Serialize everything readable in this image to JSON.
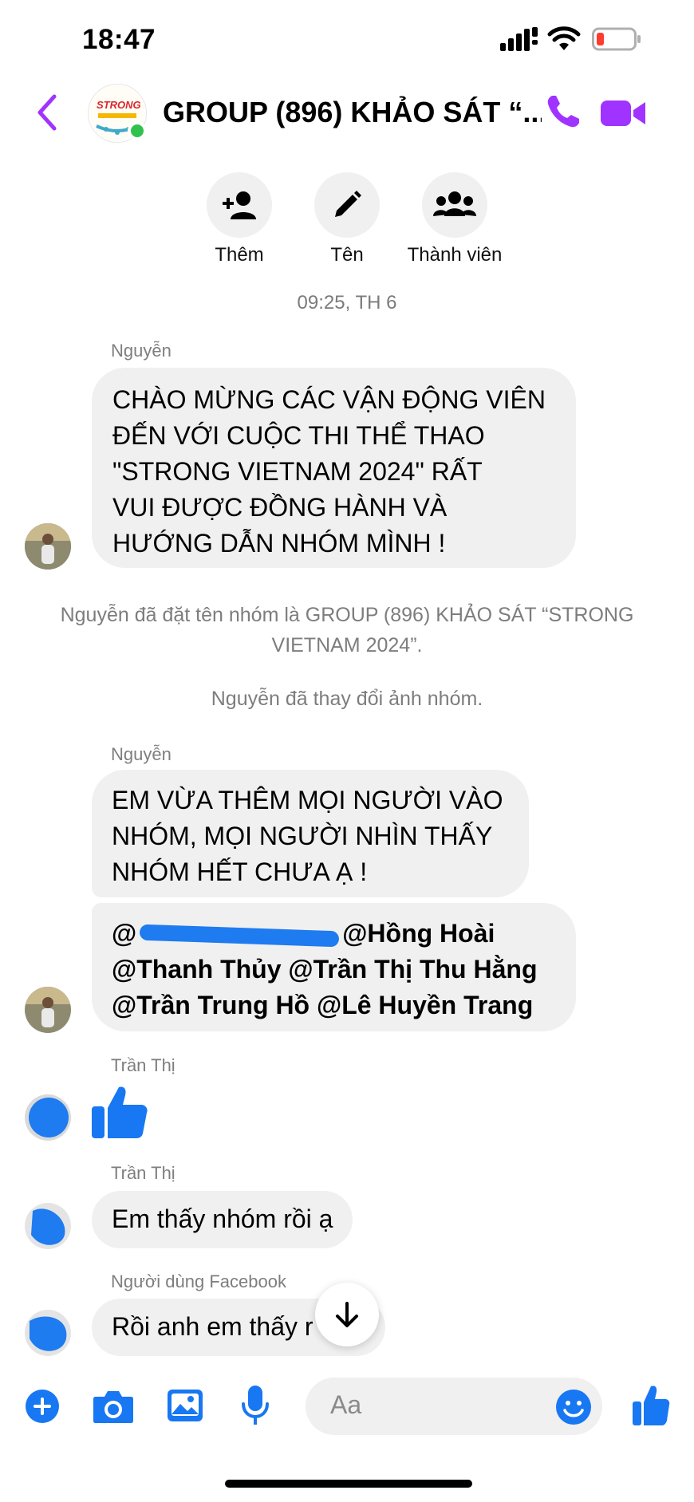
{
  "status_bar": {
    "time": "18:47"
  },
  "header": {
    "title": "GROUP (896) KHẢO SÁT “...",
    "logo_text": "STRONG"
  },
  "actions": [
    {
      "label": "Thêm",
      "icon": "add-person-icon"
    },
    {
      "label": "Tên",
      "icon": "pencil-icon"
    },
    {
      "label": "Thành viên",
      "icon": "members-icon"
    }
  ],
  "chat": {
    "timestamp": "09:25, TH 6",
    "msg1": {
      "sender": "Nguyễn",
      "lines": [
        "CHÀO MỪNG CÁC VẬN ĐỘNG VIÊN",
        "ĐẾN VỚI CUỘC THI THỂ THAO",
        "\"STRONG VIETNAM 2024\"  RẤT",
        "VUI ĐƯỢC ĐỒNG HÀNH VÀ",
        "HƯỚNG DẪN NHÓM MÌNH !"
      ]
    },
    "system1": [
      "Nguyễn đã đặt tên nhóm là GROUP (896) KHẢO SÁT “STRONG",
      "VIETNAM 2024”."
    ],
    "system2": "Nguyễn đã thay đổi ảnh nhóm.",
    "msg2": {
      "sender": "Nguyễn",
      "lines": [
        "EM VỪA THÊM MỌI NGƯỜI VÀO",
        "NHÓM, MỌI NGƯỜI NHÌN THẤY",
        "NHÓM HẾT CHƯA Ạ !"
      ],
      "mention_lines": [
        "@Hồng Hoài",
        "@Thanh Thủy @Trần Thị Thu Hằng",
        "@Trần Trung Hồ @Lê Huyền Trang"
      ],
      "mention_prefix": "@"
    },
    "msg3": {
      "sender": "Trần Thị",
      "icon": "thumbs-up-icon"
    },
    "msg4": {
      "sender": "Trần Thị",
      "text": "Em thấy nhóm rồi ạ"
    },
    "msg5": {
      "sender": "Người dùng Facebook",
      "text": "Rồi anh em thấy r"
    }
  },
  "composer": {
    "placeholder": "Aa"
  },
  "colors": {
    "accent": "#a033ff",
    "messenger_blue": "#1877f2",
    "bubble": "#f0f0f0"
  }
}
